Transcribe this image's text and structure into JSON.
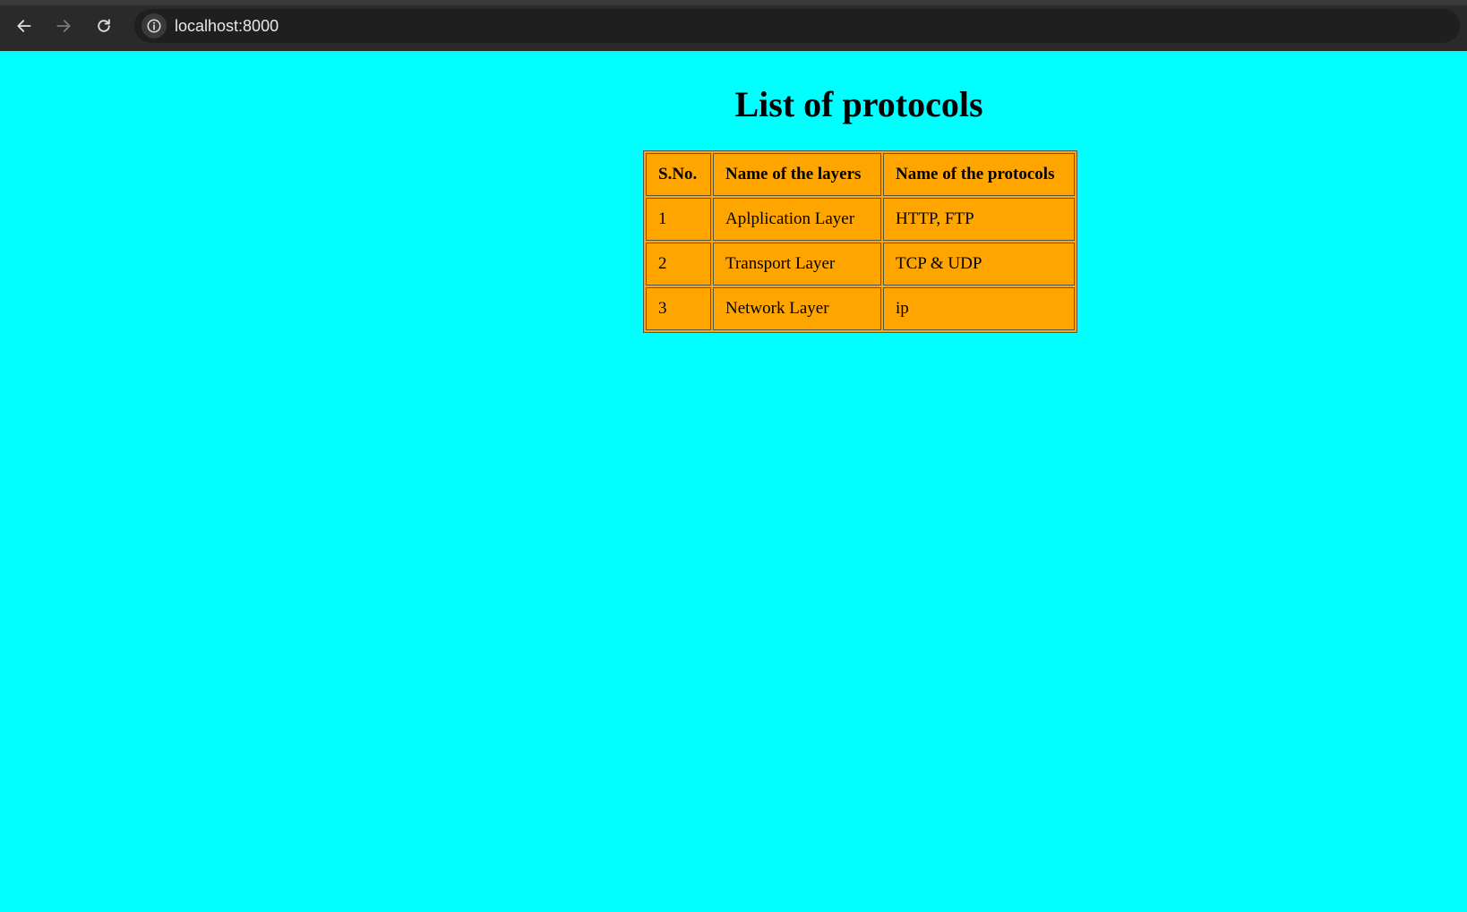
{
  "browser": {
    "url": "localhost:8000",
    "icons": {
      "back": "arrow-left-icon",
      "forward": "arrow-right-icon",
      "reload": "reload-icon",
      "site_info": "info-icon"
    }
  },
  "page": {
    "background_color": "#00ffff",
    "title": "List of protocols",
    "table": {
      "background_color": "#ffa500",
      "headers": [
        "S.No.",
        "Name of the layers",
        "Name of the protocols"
      ],
      "rows": [
        [
          "1",
          "Aplplication Layer",
          "HTTP, FTP"
        ],
        [
          "2",
          "Transport Layer",
          "TCP & UDP"
        ],
        [
          "3",
          "Network Layer",
          "ip"
        ]
      ]
    }
  }
}
